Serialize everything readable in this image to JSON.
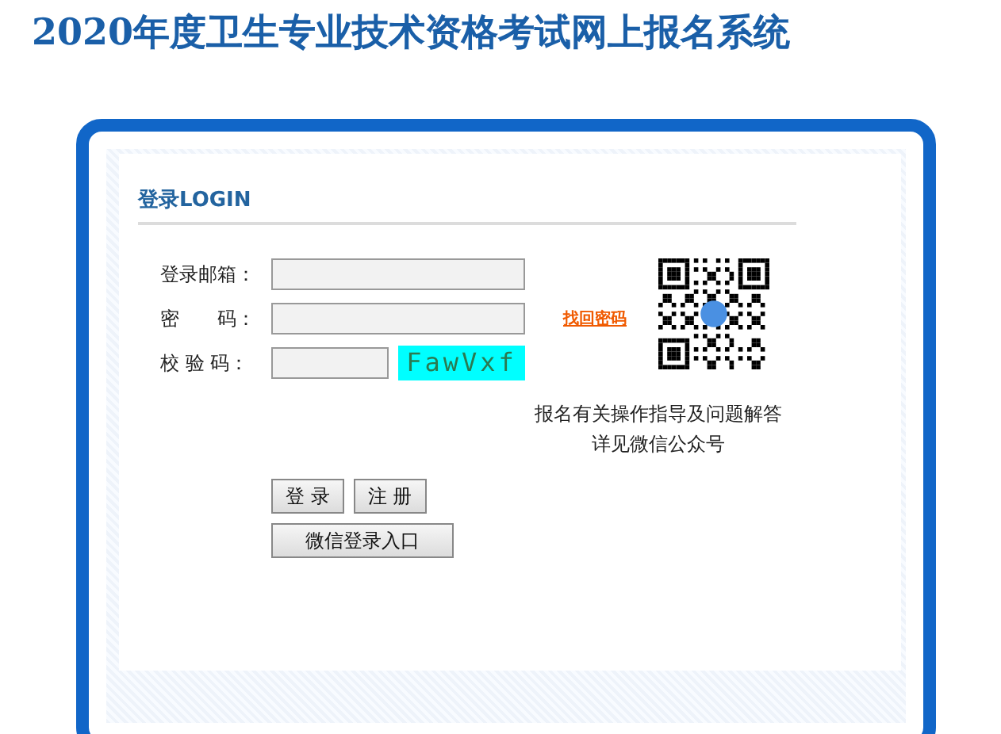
{
  "page_title": "2020年度卫生专业技术资格考试网上报名系统",
  "login": {
    "heading": "登录LOGIN",
    "fields": [
      {
        "label": "登录邮箱：",
        "kind": "text"
      },
      {
        "label": "密　　码：",
        "kind": "password"
      },
      {
        "label": "校 验 码：",
        "kind": "captcha",
        "captcha": "FawVxf"
      }
    ],
    "forgot_link": "找回密码",
    "info": [
      "报名有关操作指导及问题解答",
      "详见微信公众号"
    ],
    "buttons": [
      "登 录",
      "注 册"
    ],
    "wechat_button": "微信登录入口"
  }
}
